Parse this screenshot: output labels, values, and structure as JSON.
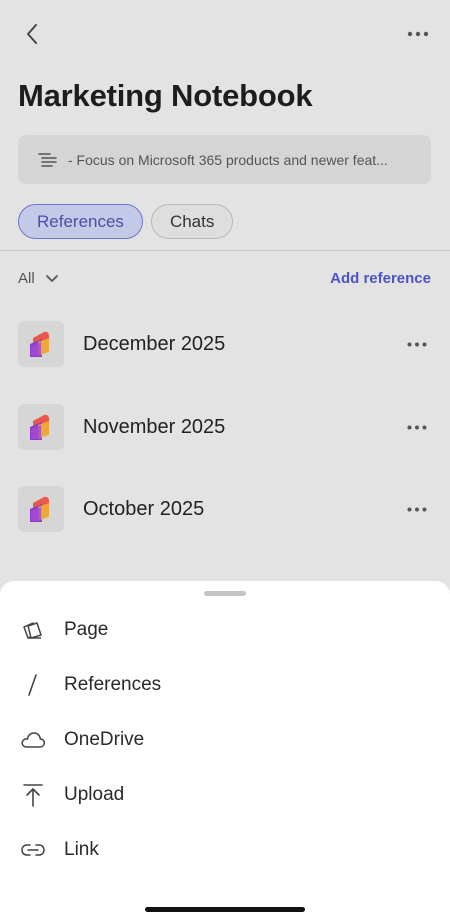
{
  "header": {
    "title": "Marketing Notebook"
  },
  "instructions": {
    "text": "- Focus on Microsoft 365 products and newer feat..."
  },
  "tabs": [
    {
      "label": "References",
      "active": true
    },
    {
      "label": "Chats",
      "active": false
    }
  ],
  "filter": {
    "label": "All",
    "add_reference_label": "Add reference"
  },
  "references": [
    {
      "label": "December 2025",
      "icon": "loop-page-icon"
    },
    {
      "label": "November 2025",
      "icon": "loop-page-icon"
    },
    {
      "label": "October 2025",
      "icon": "loop-page-icon"
    }
  ],
  "sheet": {
    "items": [
      {
        "label": "Page",
        "icon": "page-icon"
      },
      {
        "label": "References",
        "icon": "slash-icon"
      },
      {
        "label": "OneDrive",
        "icon": "cloud-icon"
      },
      {
        "label": "Upload",
        "icon": "upload-icon"
      },
      {
        "label": "Link",
        "icon": "link-icon"
      }
    ]
  },
  "colors": {
    "background": "#e3e3e3",
    "accent": "#4c55c8",
    "active_tab_bg": "#c5c9e8",
    "sheet_bg": "#ffffff"
  }
}
